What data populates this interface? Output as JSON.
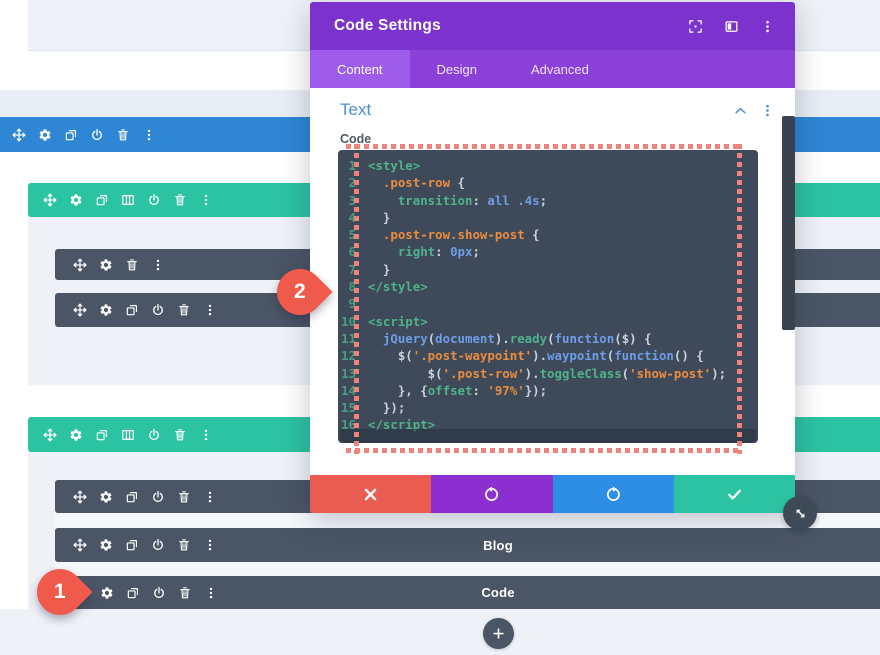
{
  "colors": {
    "section_blue": "#2e86d5",
    "row_teal": "#2cc3a2",
    "module_gray": "#4a5665",
    "modal_header_purple": "#7c32cd",
    "modal_tabbar_purple": "#8b41d8",
    "modal_tab_active_purple": "#9d5ce9",
    "editor_background": "#3e4a59",
    "dotted_border": "#ee837b",
    "link_blue": "#4a8ed6",
    "marker_red": "#f05a4b",
    "button_red": "#ea5b51",
    "button_purple": "#8c2fd0",
    "button_blue": "#2e8de5",
    "button_teal": "#2cc3a2"
  },
  "page": {
    "section_toolbar": {
      "icons": [
        "move",
        "gear",
        "duplicate",
        "power",
        "trash",
        "more"
      ]
    },
    "row_toolbar_1": {
      "icons": [
        "move",
        "gear",
        "duplicate",
        "columns",
        "power",
        "trash",
        "more"
      ]
    },
    "module_toolbar_1": {
      "icons": [
        "move",
        "gear",
        "trash",
        "more"
      ]
    },
    "module_toolbar_2": {
      "icons": [
        "move",
        "gear",
        "duplicate",
        "power",
        "trash",
        "more"
      ]
    },
    "row_toolbar_2": {
      "icons": [
        "move",
        "gear",
        "duplicate",
        "columns",
        "power",
        "trash",
        "more"
      ]
    },
    "module_toolbar_3": {
      "icons": [
        "move",
        "gear",
        "duplicate",
        "power",
        "trash",
        "more"
      ]
    },
    "module_blog": {
      "icons": [
        "move",
        "gear",
        "duplicate",
        "power",
        "trash",
        "more"
      ],
      "label": "Blog"
    },
    "module_code": {
      "icons": [
        "gear",
        "duplicate",
        "power",
        "trash",
        "more"
      ],
      "label": "Code"
    },
    "add_button_icon": "plus"
  },
  "annotations": {
    "step_1": "1",
    "step_2": "2"
  },
  "modal": {
    "title": "Code Settings",
    "header_icons": [
      "expand",
      "split",
      "more"
    ],
    "tabs": [
      {
        "label": "Content",
        "active": true
      },
      {
        "label": "Design",
        "active": false
      },
      {
        "label": "Advanced",
        "active": false
      }
    ],
    "section_title": "Text",
    "section_icons": [
      "chevron-up",
      "more"
    ],
    "field_label": "Code",
    "code_lines": [
      {
        "n": "1",
        "t": [
          [
            "g",
            "<style>"
          ]
        ]
      },
      {
        "n": "2",
        "t": [
          [
            "w",
            "  "
          ],
          [
            "o",
            ".post-row"
          ],
          [
            "w",
            " {"
          ]
        ]
      },
      {
        "n": "3",
        "t": [
          [
            "w",
            "    "
          ],
          [
            "g",
            "transition"
          ],
          [
            "w",
            ": "
          ],
          [
            "b",
            "all"
          ],
          [
            "w",
            " "
          ],
          [
            "b",
            ".4s"
          ],
          [
            "w",
            ";"
          ]
        ]
      },
      {
        "n": "4",
        "t": [
          [
            "w",
            "  }"
          ]
        ]
      },
      {
        "n": "5",
        "t": [
          [
            "w",
            "  "
          ],
          [
            "o",
            ".post-row.show-post"
          ],
          [
            "w",
            " {"
          ]
        ]
      },
      {
        "n": "6",
        "t": [
          [
            "w",
            "    "
          ],
          [
            "g",
            "right"
          ],
          [
            "w",
            ": "
          ],
          [
            "b",
            "0px"
          ],
          [
            "w",
            ";"
          ]
        ]
      },
      {
        "n": "7",
        "t": [
          [
            "w",
            "  }"
          ]
        ]
      },
      {
        "n": "8",
        "t": [
          [
            "g",
            "</style>"
          ]
        ]
      },
      {
        "n": "9",
        "t": []
      },
      {
        "n": "10",
        "t": [
          [
            "g",
            "<script>"
          ]
        ]
      },
      {
        "n": "11",
        "t": [
          [
            "w",
            "  "
          ],
          [
            "b",
            "jQuery"
          ],
          [
            "w",
            "("
          ],
          [
            "b",
            "document"
          ],
          [
            "w",
            ")."
          ],
          [
            "g",
            "ready"
          ],
          [
            "w",
            "("
          ],
          [
            "b",
            "function"
          ],
          [
            "w",
            "($) {"
          ]
        ]
      },
      {
        "n": "12",
        "t": [
          [
            "w",
            "    $("
          ],
          [
            "o",
            "'.post-waypoint'"
          ],
          [
            "w",
            ")."
          ],
          [
            "b",
            "waypoint"
          ],
          [
            "w",
            "("
          ],
          [
            "b",
            "function"
          ],
          [
            "w",
            "() {"
          ]
        ]
      },
      {
        "n": "13",
        "t": [
          [
            "w",
            "        $("
          ],
          [
            "o",
            "'.post-row'"
          ],
          [
            "w",
            ")."
          ],
          [
            "g",
            "toggleClass"
          ],
          [
            "w",
            "("
          ],
          [
            "o",
            "'show-post'"
          ],
          [
            "w",
            ");"
          ]
        ]
      },
      {
        "n": "14",
        "t": [
          [
            "w",
            "    }, {"
          ],
          [
            "g",
            "offset"
          ],
          [
            "w",
            ": "
          ],
          [
            "o",
            "'97%'"
          ],
          [
            "w",
            "});"
          ]
        ]
      },
      {
        "n": "15",
        "t": [
          [
            "w",
            "  });"
          ]
        ]
      },
      {
        "n": "16",
        "t": [
          [
            "g",
            "</script>"
          ]
        ]
      }
    ],
    "footer_buttons": [
      {
        "name": "cancel",
        "icon": "close",
        "color": "#ea5b51"
      },
      {
        "name": "undo",
        "icon": "undo",
        "color": "#8c2fd0"
      },
      {
        "name": "redo",
        "icon": "redo",
        "color": "#2e8de5"
      },
      {
        "name": "save",
        "icon": "check",
        "color": "#2cc3a2"
      }
    ]
  }
}
